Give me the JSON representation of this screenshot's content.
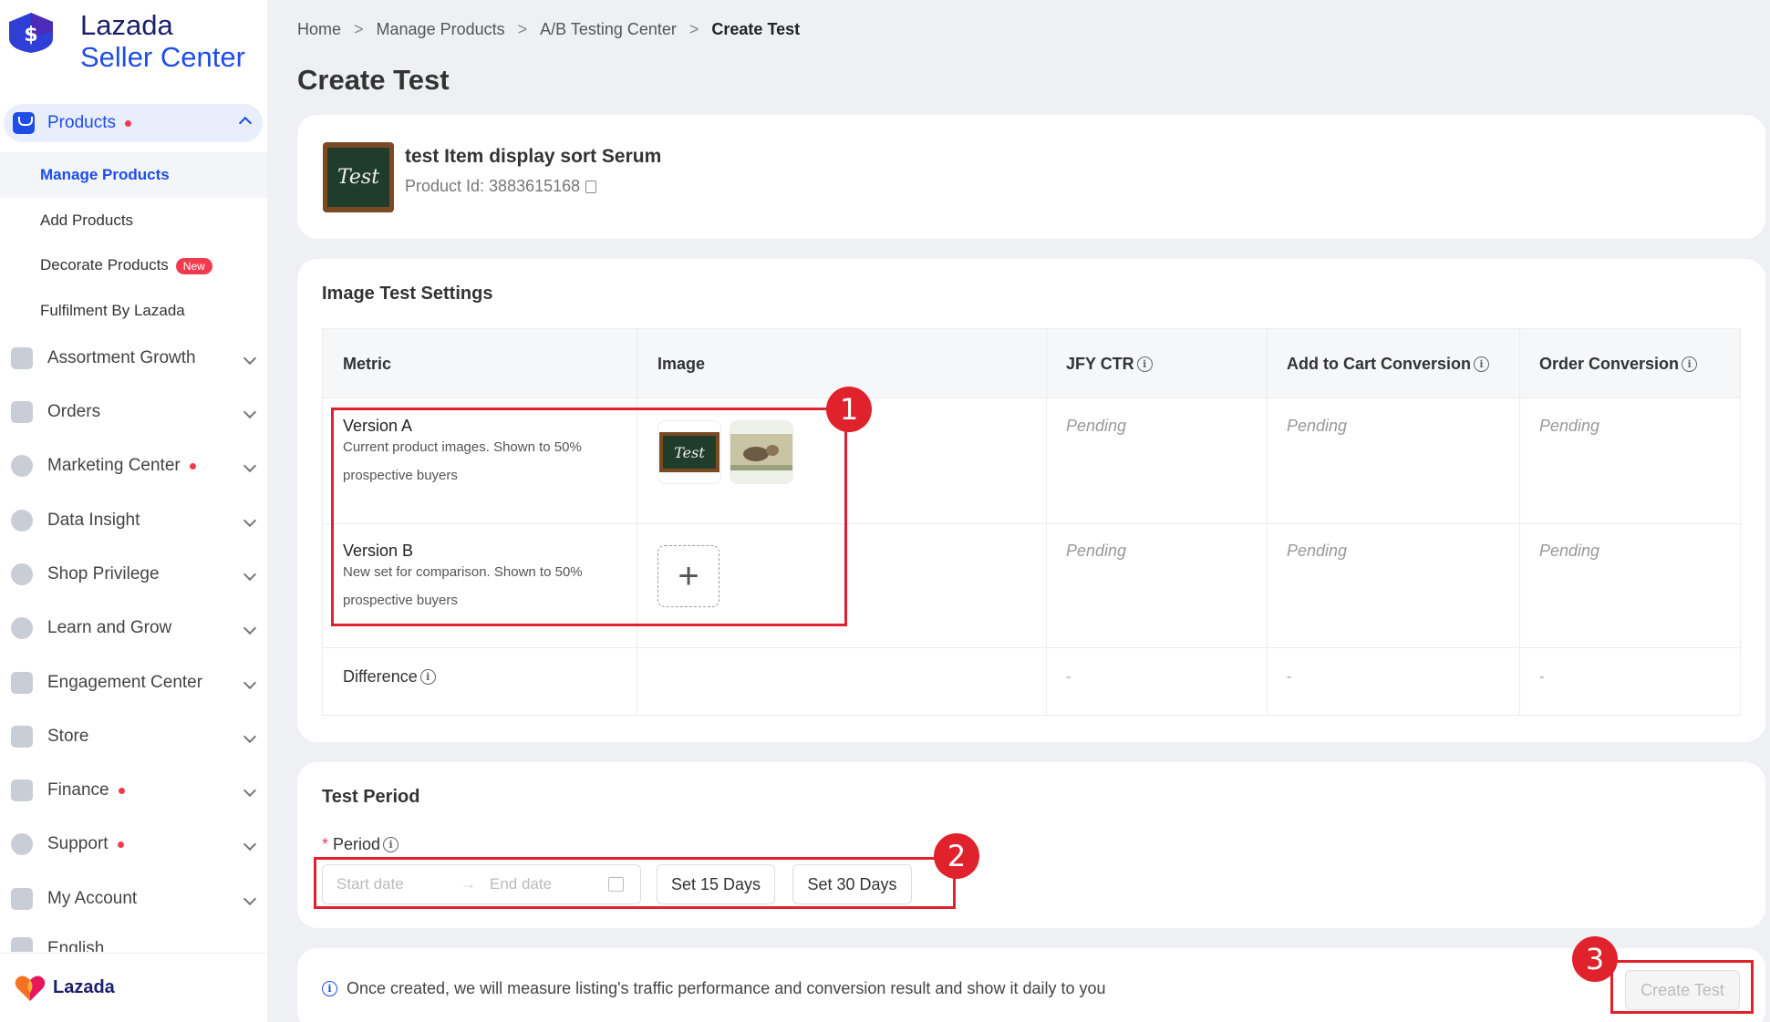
{
  "brand": {
    "line1": "Lazada",
    "line2": "Seller Center",
    "footer_name": "Lazada",
    "colors": {
      "primary": "#1e4de8",
      "navy": "#1b1e6b",
      "alert": "#f03b4f",
      "annotation": "#e0222d"
    }
  },
  "sidebar": {
    "active_section": {
      "label": "Products",
      "icon": "products-bag-icon"
    },
    "sub_items": [
      {
        "label": "Manage Products"
      },
      {
        "label": "Add Products"
      },
      {
        "label": "Decorate Products",
        "badge": "New"
      },
      {
        "label": "Fulfilment By Lazada"
      }
    ],
    "sections": [
      {
        "label": "Assortment Growth",
        "icon": "chart-icon"
      },
      {
        "label": "Orders",
        "icon": "orders-icon"
      },
      {
        "label": "Marketing Center",
        "icon": "marketing-icon"
      },
      {
        "label": "Data Insight",
        "icon": "data-icon"
      },
      {
        "label": "Shop Privilege",
        "icon": "dollar-icon"
      },
      {
        "label": "Learn and Grow",
        "icon": "learn-icon"
      },
      {
        "label": "Engagement Center",
        "icon": "engagement-icon"
      },
      {
        "label": "Store",
        "icon": "store-icon"
      },
      {
        "label": "Finance",
        "icon": "wallet-icon"
      },
      {
        "label": "Support",
        "icon": "help-icon"
      },
      {
        "label": "My Account",
        "icon": "user-icon"
      },
      {
        "label": "English",
        "icon": "language-icon"
      }
    ]
  },
  "breadcrumb": [
    "Home",
    "Manage Products",
    "A/B Testing Center",
    "Create Test"
  ],
  "page_title": "Create Test",
  "product": {
    "name": "test Item display sort Serum",
    "id_text": "Product Id: 3883615168",
    "thumb_text": "Test"
  },
  "image_test": {
    "title": "Image Test Settings",
    "columns": [
      "Metric",
      "Image",
      "JFY CTR",
      "Add to Cart Conversion",
      "Order Conversion"
    ],
    "rows": [
      {
        "title": "Version A",
        "desc": "Current product images. Shown to 50% prospective buyers",
        "values": [
          "Pending",
          "Pending",
          "Pending"
        ]
      },
      {
        "title": "Version B",
        "desc": "New set for comparison. Shown to 50% prospective buyers",
        "values": [
          "Pending",
          "Pending",
          "Pending"
        ]
      }
    ],
    "difference": {
      "label": "Difference",
      "values": [
        "-",
        "-",
        "-"
      ]
    },
    "add_symbol": "+"
  },
  "period": {
    "title": "Test Period",
    "label": "Period",
    "required_mark": "*",
    "start_placeholder": "Start date",
    "end_placeholder": "End date",
    "arrow": "→",
    "btn_15": "Set 15 Days",
    "btn_30": "Set 30 Days"
  },
  "footer": {
    "info": "Once created, we will measure listing's traffic performance and conversion result and show it daily to you",
    "create_btn": "Create Test"
  },
  "info_glyph": "i",
  "annotations": [
    "1",
    "2",
    "3"
  ]
}
